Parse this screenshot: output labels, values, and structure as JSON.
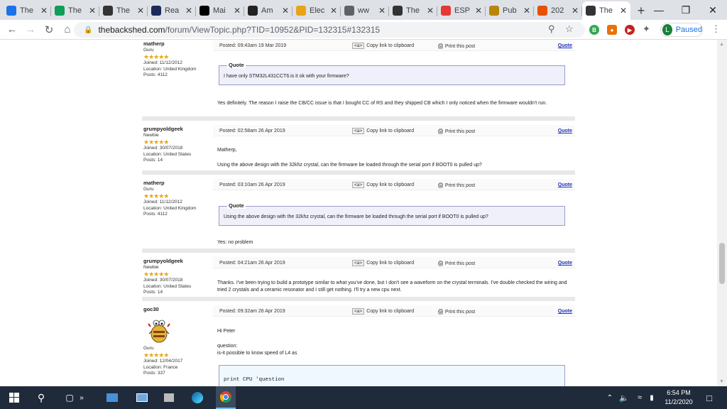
{
  "tabs": [
    {
      "icon": "triangle-icon",
      "title": "The",
      "color": "#1a73e8"
    },
    {
      "icon": "globe-icon",
      "title": "The",
      "color": "#0f9d58"
    },
    {
      "icon": "pb-icon",
      "title": "The",
      "color": "#333333"
    },
    {
      "icon": "news-icon",
      "title": "Rea",
      "color": "#1c2a5a"
    },
    {
      "icon": "aol-icon",
      "title": "Mai",
      "color": "#000000"
    },
    {
      "icon": "amazon-icon",
      "title": "Am",
      "color": "#222222"
    },
    {
      "icon": "bag-icon",
      "title": "Elec",
      "color": "#e8a317"
    },
    {
      "icon": "globe-icon",
      "title": "ww",
      "color": "#5f6368"
    },
    {
      "icon": "tbs-icon",
      "title": "The",
      "color": "#333333"
    },
    {
      "icon": "esp-icon",
      "title": "ESP",
      "color": "#e53935"
    },
    {
      "icon": "puppy-icon",
      "title": "Pub",
      "color": "#b8860b"
    },
    {
      "icon": "aliexpress-icon",
      "title": "202",
      "color": "#e65100"
    },
    {
      "icon": "tbs-icon",
      "title": "The",
      "color": "#333333",
      "active": true
    }
  ],
  "toolbar": {
    "url_host": "thebackshed.com",
    "url_path": "/forum/ViewTopic.php?TID=10952&PID=132315#132315",
    "profile_initial": "L",
    "profile_status": "Paused"
  },
  "posts": [
    {
      "author": "matherp",
      "rank": "Guru",
      "joined": "Joined: 11/12/2012",
      "location": "Location: United Kingdom",
      "posts": "Posts: 4112",
      "posted": "Posted: 09:43am 19 Mar 2019",
      "quote_label": "Quote",
      "quote_text": "I have only STM32L431CCT6.is it ok with your firmware?",
      "body": "Yes definitely. The reason I raise the CB/CC issue is that I bought CC of RS and they shipped CB which I only noticed when the firmware wouldn't run."
    },
    {
      "author": "grumpyoldgeek",
      "rank": "Newbie",
      "joined": "Joined: 30/07/2018",
      "location": "Location: United States",
      "posts": "Posts: 14",
      "posted": "Posted: 02:58am 26 Apr 2019",
      "body_1": "Matherp,",
      "body_2": "Using the above design with the 32khz crystal, can the firmware be loaded through the serial port if BOOT0 is pulled up?"
    },
    {
      "author": "matherp",
      "rank": "Guru",
      "joined": "Joined: 11/12/2012",
      "location": "Location: United Kingdom",
      "posts": "Posts: 4112",
      "posted": "Posted: 03:10am 26 Apr 2019",
      "quote_label": "Quote",
      "quote_text": "Using the above design with the 32khz crystal, can the firmware be loaded through the serial port if BOOT0 is pulled up?",
      "body": "Yes: no problem"
    },
    {
      "author": "grumpyoldgeek",
      "rank": "Newbie",
      "joined": "Joined: 30/07/2018",
      "location": "Location: United States",
      "posts": "Posts: 14",
      "posted": "Posted: 04:21am 26 Apr 2019",
      "body": "Thanks. I've been trying to build a prototype similar to what you've done, but I don't see a waveform on the crystal terminals. I've double checked the wiring and tried 2 crystals and a ceramic resonator and I still get nothing. I'll try a new cpu next."
    },
    {
      "author": "goc30",
      "rank": "Guru",
      "joined": "Joined: 12/04/2017",
      "location": "Location: France",
      "posts": "Posts: 337",
      "posted": "Posted: 09:32am 26 Apr 2019",
      "body_1": "Hi Peter",
      "body_2": "question:",
      "body_3": "is-it possible to know speed of L4 as",
      "code": "print CPU 'question"
    }
  ],
  "post_actions": {
    "copy_tag": "<a>",
    "copy_label": "Copy link to clipboard",
    "print_label": "Print this post",
    "quote_link": "Quote",
    "stars": "★★★★★"
  },
  "taskbar": {
    "time": "6:54 PM",
    "date": "11/2/2020"
  }
}
